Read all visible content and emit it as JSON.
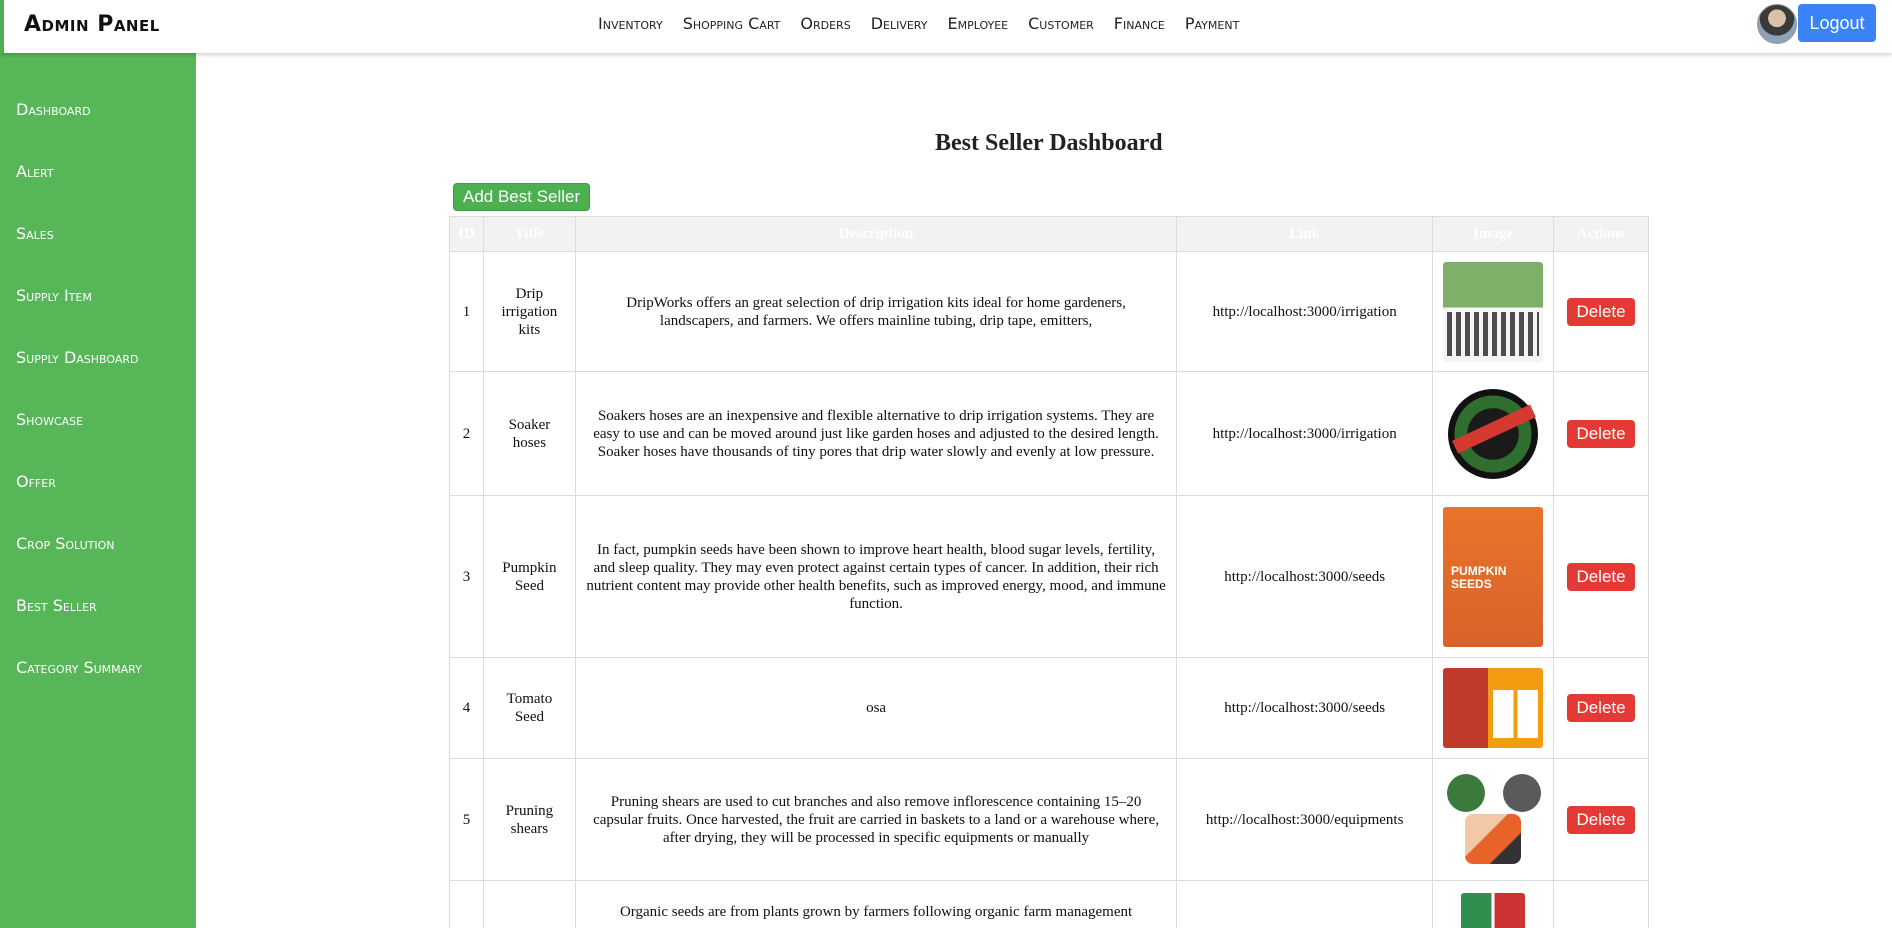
{
  "header": {
    "brand": "Admin Panel",
    "nav": [
      "Inventory",
      "Shopping Cart",
      "Orders",
      "Delivery",
      "Employee",
      "Customer",
      "Finance",
      "Payment"
    ],
    "logout_label": "Logout"
  },
  "sidebar": {
    "items": [
      "Dashboard",
      "Alert",
      "Sales",
      "Supply Item",
      "Supply Dashboard",
      "Showcase",
      "Offer",
      "Crop Solution",
      "Best Seller",
      "Category Summary"
    ]
  },
  "main": {
    "title": "Best Seller Dashboard",
    "add_label": "Add Best Seller",
    "columns": [
      "ID",
      "Title",
      "Description",
      "Link",
      "Image",
      "Actions"
    ],
    "delete_label": "Delete",
    "rows": [
      {
        "id": "1",
        "title": "Drip irrigation kits",
        "description": "DripWorks offers an great selection of drip irrigation kits ideal for home gardeners, landscapers, and farmers. We offers mainline tubing, drip tape, emitters,",
        "link": "http://localhost:3000/irrigation",
        "image": "drip-irrigation-kit-image"
      },
      {
        "id": "2",
        "title": "Soaker hoses",
        "description": "Soakers hoses are an inexpensive and flexible alternative to drip irrigation systems. They are easy to use and can be moved around just like garden hoses and adjusted to the desired length. Soaker hoses have thousands of tiny pores that drip water slowly and evenly at low pressure.",
        "link": "http://localhost:3000/irrigation",
        "image": "soaker-hose-image"
      },
      {
        "id": "3",
        "title": "Pumpkin Seed",
        "description": "In fact, pumpkin seeds have been shown to improve heart health, blood sugar levels, fertility, and sleep quality. They may even protect against certain types of cancer. In addition, their rich nutrient content may provide other health benefits, such as improved energy, mood, and immune function.",
        "link": "http://localhost:3000/seeds",
        "image": "pumpkin-seeds-pack-image"
      },
      {
        "id": "4",
        "title": "Tomato Seed",
        "description": "osa",
        "link": "http://localhost:3000/seeds",
        "image": "tomato-seeds-image"
      },
      {
        "id": "5",
        "title": "Pruning shears",
        "description": "Pruning shears are used to cut branches and also remove inflorescence containing 15–20 capsular fruits. Once harvested, the fruit are carried in baskets to a land or a warehouse where, after drying, they will be processed in specific equipments or manually",
        "link": "http://localhost:3000/equipments",
        "image": "pruning-shears-image"
      },
      {
        "id": "",
        "title": "",
        "description": "Organic seeds are from plants grown by farmers following organic farm management",
        "link": "",
        "image": "organic-seeds-image"
      }
    ]
  },
  "colors": {
    "sidebar": "#57b657",
    "add_button": "#4caf50",
    "delete_button": "#e53935",
    "logout_button": "#3b82f6"
  }
}
